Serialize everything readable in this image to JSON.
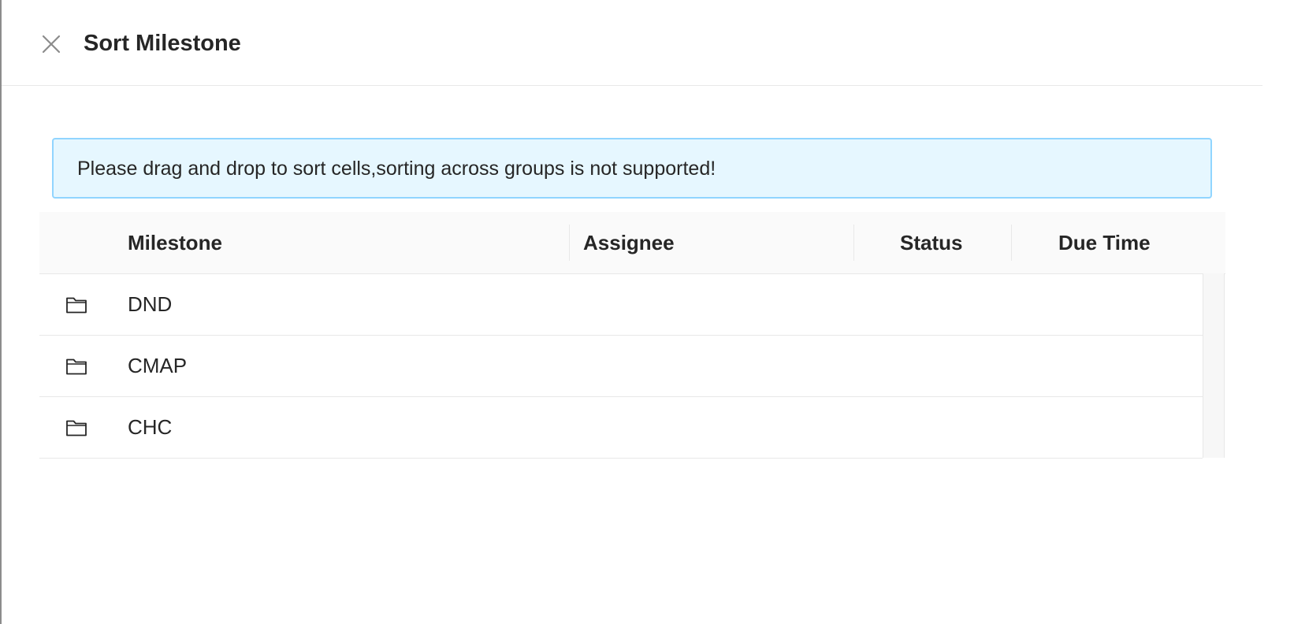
{
  "dialog": {
    "title": "Sort Milestone"
  },
  "alert": {
    "message": "Please drag and drop to sort cells,sorting across groups is not supported!"
  },
  "table": {
    "headers": {
      "milestone": "Milestone",
      "assignee": "Assignee",
      "status": "Status",
      "due_time": "Due Time"
    },
    "rows": [
      {
        "icon": "folder-icon",
        "milestone": "DND"
      },
      {
        "icon": "folder-icon",
        "milestone": "CMAP"
      },
      {
        "icon": "folder-icon",
        "milestone": "CHC"
      }
    ]
  },
  "colors": {
    "alert_background": "#e6f7ff",
    "alert_border": "#91d5ff",
    "header_background": "#fafafa",
    "divider": "#e8e8e8"
  }
}
